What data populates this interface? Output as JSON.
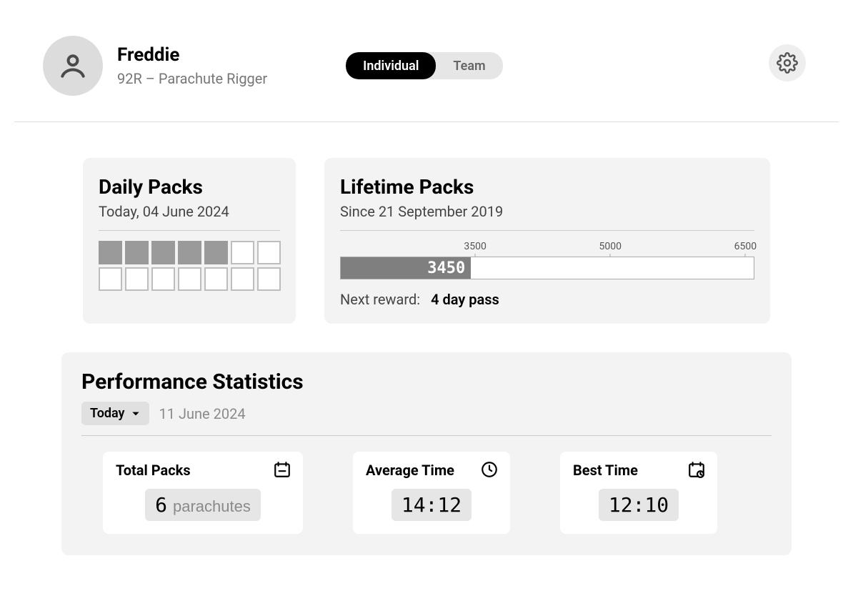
{
  "user": {
    "name": "Freddie",
    "role": "92R – Parachute Rigger"
  },
  "view_tabs": {
    "individual": "Individual",
    "team": "Team",
    "active": "individual"
  },
  "daily": {
    "title": "Daily Packs",
    "subtitle": "Today, 04 June 2024",
    "total_cells": 14,
    "filled": 5
  },
  "lifetime": {
    "title": "Lifetime Packs",
    "subtitle": "Since 21 September 2019",
    "value": 3450,
    "min": 2000,
    "max": 6600,
    "ticks": [
      3500,
      5000,
      6500
    ],
    "next_reward_label": "Next reward:",
    "next_reward_value": "4 day pass"
  },
  "perf": {
    "title": "Performance Statistics",
    "range_label": "Today",
    "date": "11 June 2024",
    "total_packs": {
      "title": "Total Packs",
      "value": 6,
      "unit": "parachutes"
    },
    "avg_time": {
      "title": "Average Time",
      "value": "14:12"
    },
    "best_time": {
      "title": "Best Time",
      "value": "12:10"
    }
  },
  "chart_data": {
    "type": "bar",
    "title": "Lifetime Packs",
    "categories": [
      "Lifetime"
    ],
    "values": [
      3450
    ],
    "xlabel": "",
    "ylabel": "Packs",
    "ylim": [
      2000,
      6600
    ],
    "ticks": [
      3500,
      5000,
      6500
    ]
  }
}
